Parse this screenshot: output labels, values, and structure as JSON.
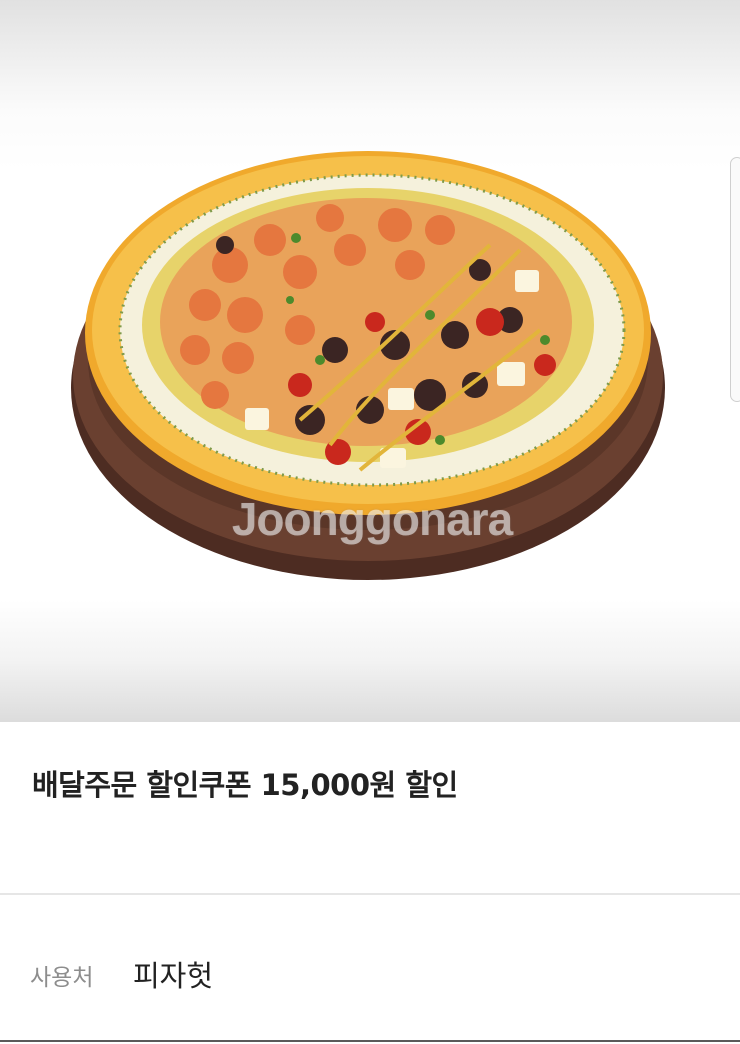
{
  "product": {
    "image_alt": "pizza-photo",
    "watermark": "Joonggonara"
  },
  "coupon": {
    "title": "배달주문 할인쿠폰 15,000원 할인"
  },
  "details": {
    "usage_label": "사용처",
    "usage_value": "피자헛"
  },
  "colors": {
    "crust": "#f2b33a",
    "board": "#5b3628",
    "text_primary": "#222222",
    "text_secondary": "#8d8d8d"
  }
}
